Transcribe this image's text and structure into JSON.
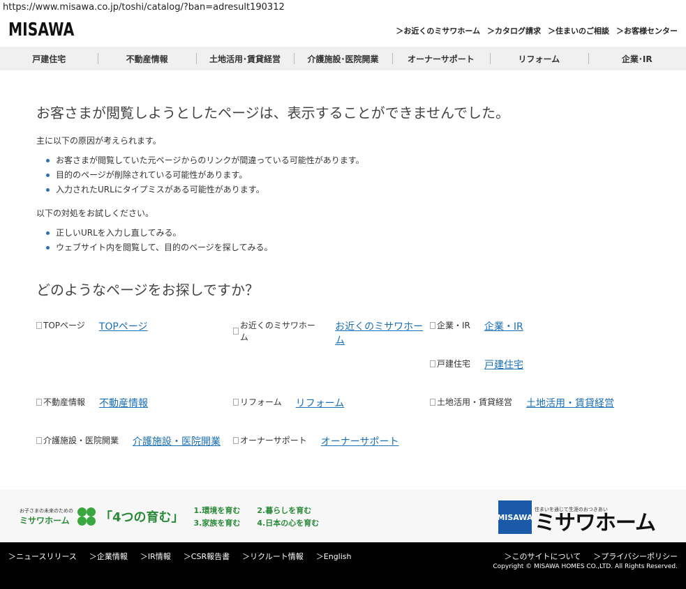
{
  "browser": {
    "url": "https://www.misawa.co.jp/toshi/catalog/?ban=adresult190312"
  },
  "header": {
    "logo": "MISAWA",
    "util_links": [
      "＞お近くのミサワホーム",
      "＞カタログ請求",
      "＞住まいのご相談",
      "＞お客様センター"
    ]
  },
  "global_nav": [
    "戸建住宅",
    "不動産情報",
    "土地活用･賃貸経営",
    "介護施設･医院開業",
    "オーナーサポート",
    "リフォーム",
    "企業･IR"
  ],
  "main": {
    "title": "お客さまが閲覧しようとしたページは、表示することができませんでした。",
    "causes_intro": "主に以下の原因が考えられます。",
    "causes": [
      "お客さまが閲覧していた元ページからのリンクが間違っている可能性があります。",
      "目的のページが削除されている可能性があります。",
      "入力されたURLにタイプミスがある可能性があります。"
    ],
    "actions_intro": "以下の対処をお試しください。",
    "actions": [
      "正しいURLを入力し直してみる。",
      "ウェブサイト内を閲覧して、目的のページを探してみる。"
    ],
    "search_title": "どのようなページをお探しですか？",
    "links": [
      {
        "alt": "TOPページ",
        "label": "TOPページ"
      },
      {
        "alt": "お近くのミサワホーム",
        "label": "お近くのミサワホーム"
      },
      {
        "alt": "企業・IR",
        "label": "企業・IR"
      },
      {
        "alt": "戸建住宅",
        "label": "戸建住宅"
      },
      {
        "alt": "不動産情報",
        "label": "不動産情報"
      },
      {
        "alt": "リフォーム",
        "label": "リフォーム"
      },
      {
        "alt": "土地活用・賃貸経営",
        "label": "土地活用・賃貸経営"
      },
      {
        "alt": "介護施設・医院開業",
        "label": "介護施設・医院開業"
      },
      {
        "alt": "オーナーサポート",
        "label": "オーナーサポート"
      }
    ]
  },
  "campaign": {
    "small": "お子さまの未来のための",
    "brand": "ミサワホーム",
    "slogan": "「4つの育む」",
    "items": [
      "1.環境を育む",
      "2.暮らしを育む",
      "3.家族を育む",
      "4.日本の心を育む"
    ]
  },
  "brand": {
    "box": "MISAWA",
    "tagline": "住まいを通じて生涯のおつきあい",
    "kana": "ミサワホーム"
  },
  "footer": {
    "left_links": [
      "＞ニュースリリース",
      "＞企業情報",
      "＞IR情報",
      "＞CSR報告書",
      "＞リクルート情報",
      "＞English"
    ],
    "right_links": [
      "＞このサイトについて",
      "＞プライバシーポリシー"
    ],
    "copyright": "Copyright © MISAWA HOMES CO.,LTD. All Rights Reserved."
  }
}
